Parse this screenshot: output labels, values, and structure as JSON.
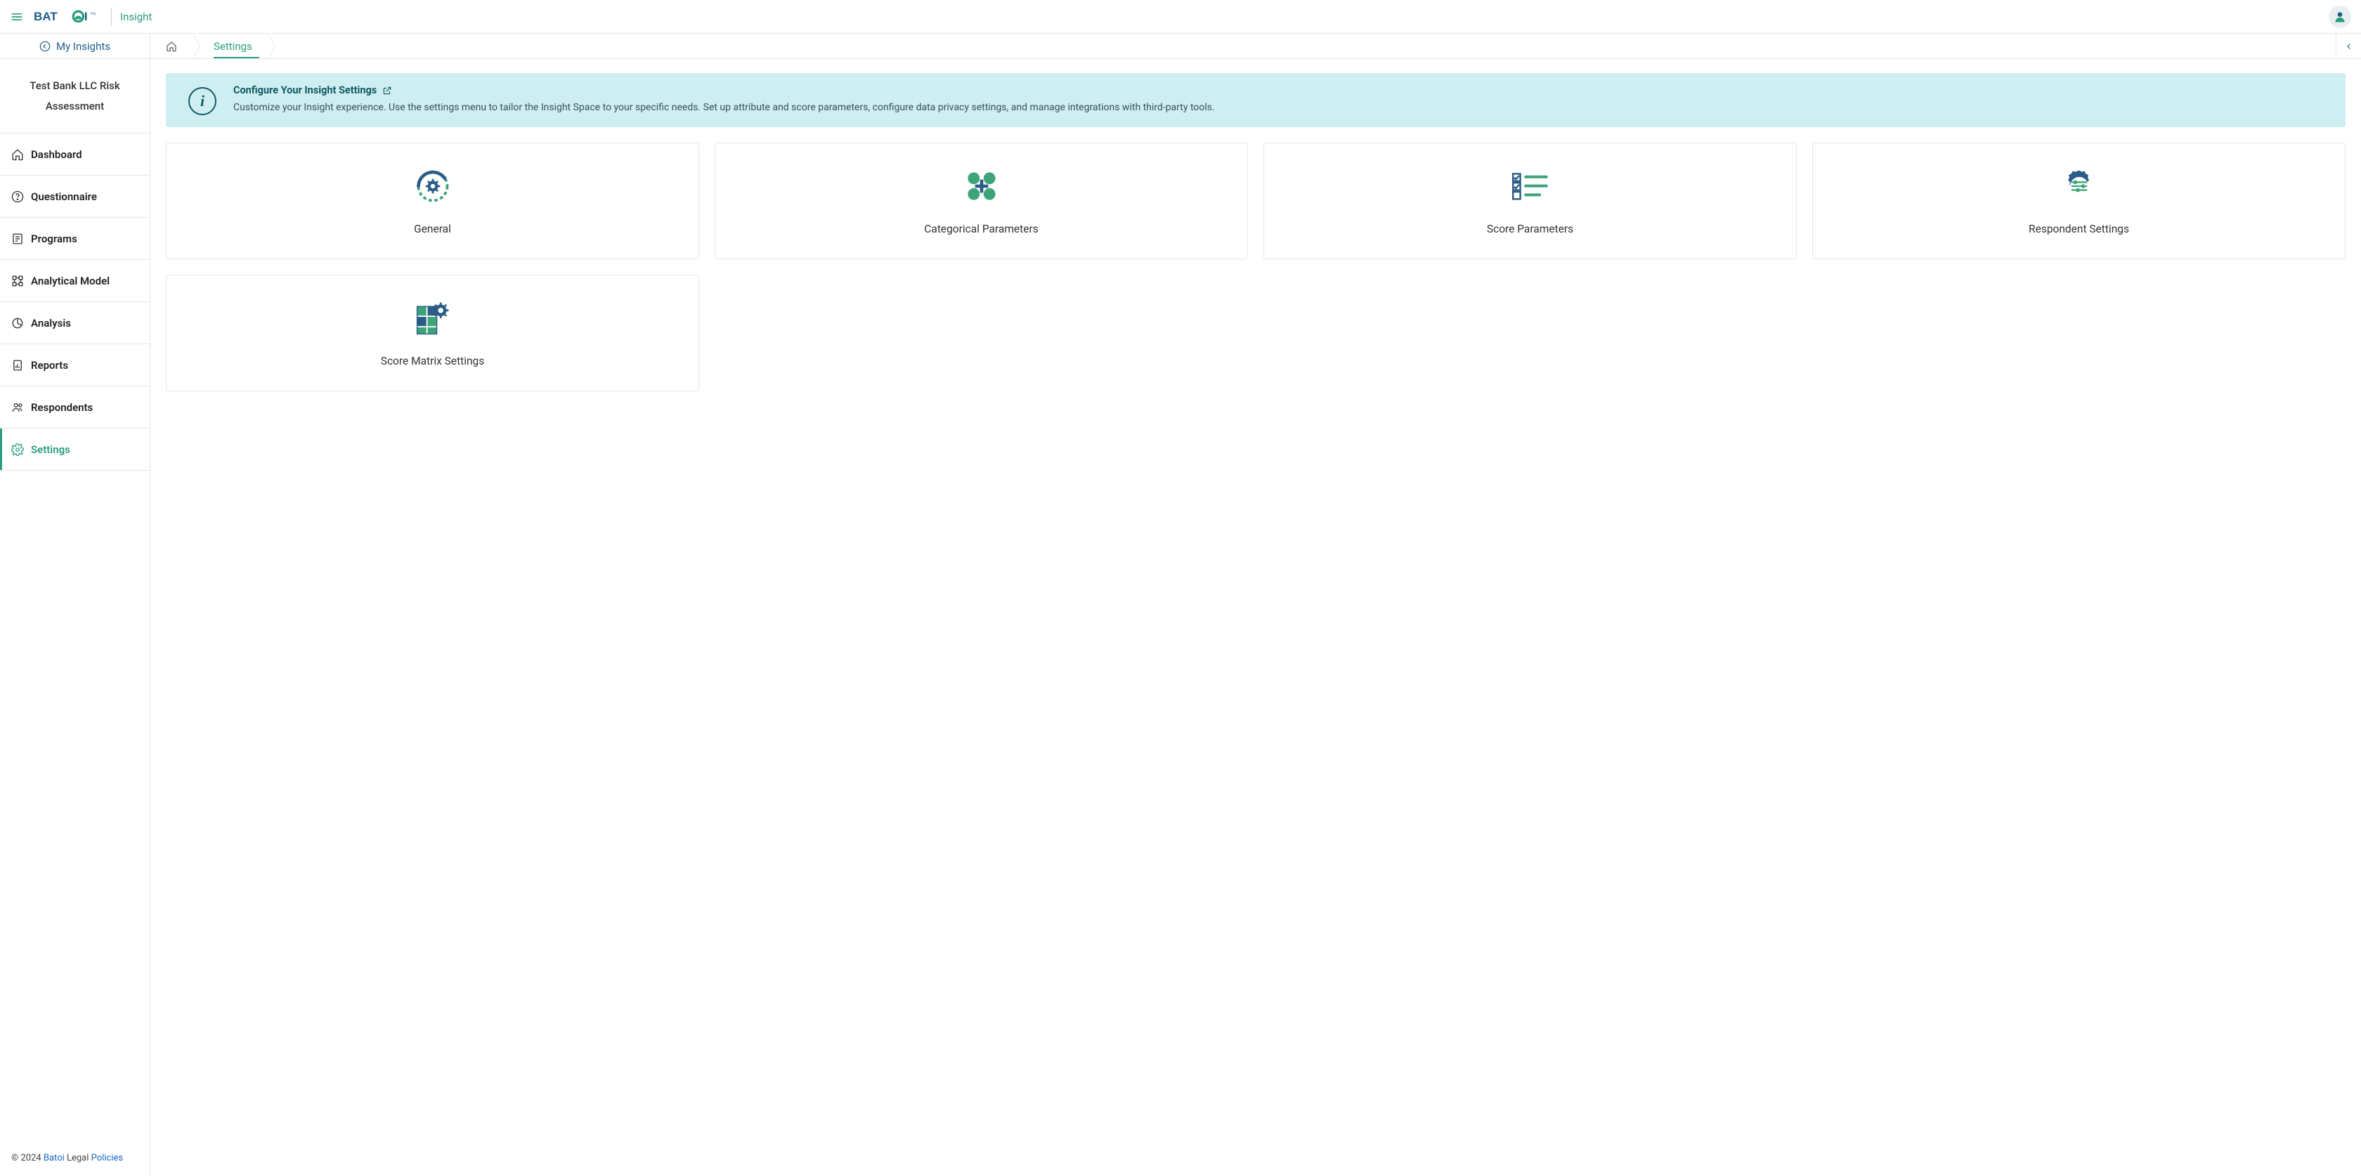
{
  "header": {
    "brand_insight": "Insight",
    "logo_text": "BATOI"
  },
  "sidebar": {
    "back_label": "My Insights",
    "project_title": "Test Bank LLC Risk Assessment",
    "items": [
      {
        "label": "Dashboard"
      },
      {
        "label": "Questionnaire"
      },
      {
        "label": "Programs"
      },
      {
        "label": "Analytical Model"
      },
      {
        "label": "Analysis"
      },
      {
        "label": "Reports"
      },
      {
        "label": "Respondents"
      },
      {
        "label": "Settings"
      }
    ],
    "footer_prefix": "© 2024 ",
    "footer_link1": "Batoi",
    "footer_mid": " Legal ",
    "footer_link2": "Policies"
  },
  "breadcrumb": {
    "home": "",
    "current": "Settings"
  },
  "banner": {
    "title": "Configure Your Insight Settings",
    "description": "Customize your Insight experience. Use the settings menu to tailor the Insight Space to your specific needs. Set up attribute and score parameters, configure data privacy settings, and manage integrations with third-party tools."
  },
  "cards": [
    {
      "label": "General"
    },
    {
      "label": "Categorical Parameters"
    },
    {
      "label": "Score Parameters"
    },
    {
      "label": "Respondent Settings"
    },
    {
      "label": "Score Matrix Settings"
    }
  ]
}
